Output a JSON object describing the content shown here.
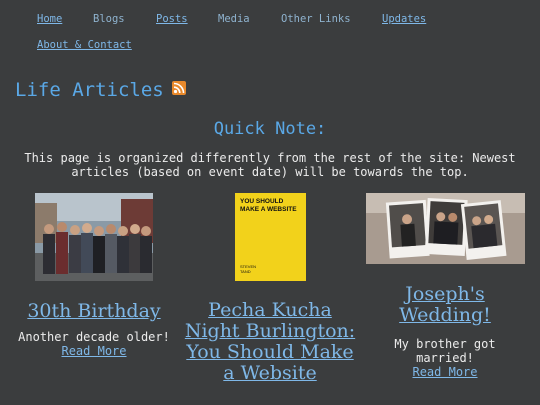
{
  "nav": {
    "items": [
      {
        "label": "Home"
      },
      {
        "label": "Blogs"
      },
      {
        "label": "Posts"
      },
      {
        "label": "Media"
      },
      {
        "label": "Other Links"
      },
      {
        "label": "Updates"
      },
      {
        "label": "About & Contact"
      }
    ]
  },
  "page": {
    "heading": "Life Articles",
    "rss_icon": "rss-icon",
    "quick_note_title": "Quick Note:",
    "quick_note_text": "This page is organized differently from the rest of the site: Newest articles (based on event date) will be towards the top."
  },
  "articles": [
    {
      "title": "30th Birthday",
      "description": "Another decade older!",
      "read_more": "Read More"
    },
    {
      "title": "Pecha Kucha Night Burlington: You Should Make a Website",
      "book_cover": {
        "title": "YOU SHOULD MAKE A WEBSITE",
        "author": "STEVEN TAND",
        "color": "#f2d21b"
      }
    },
    {
      "title": "Joseph's Wedding!",
      "description": "My brother got married!",
      "read_more": "Read More"
    }
  ],
  "colors": {
    "background": "#3b3d3e",
    "accent": "#5aa8e6",
    "link": "#7fb8e8",
    "rss": "#e8892b"
  }
}
